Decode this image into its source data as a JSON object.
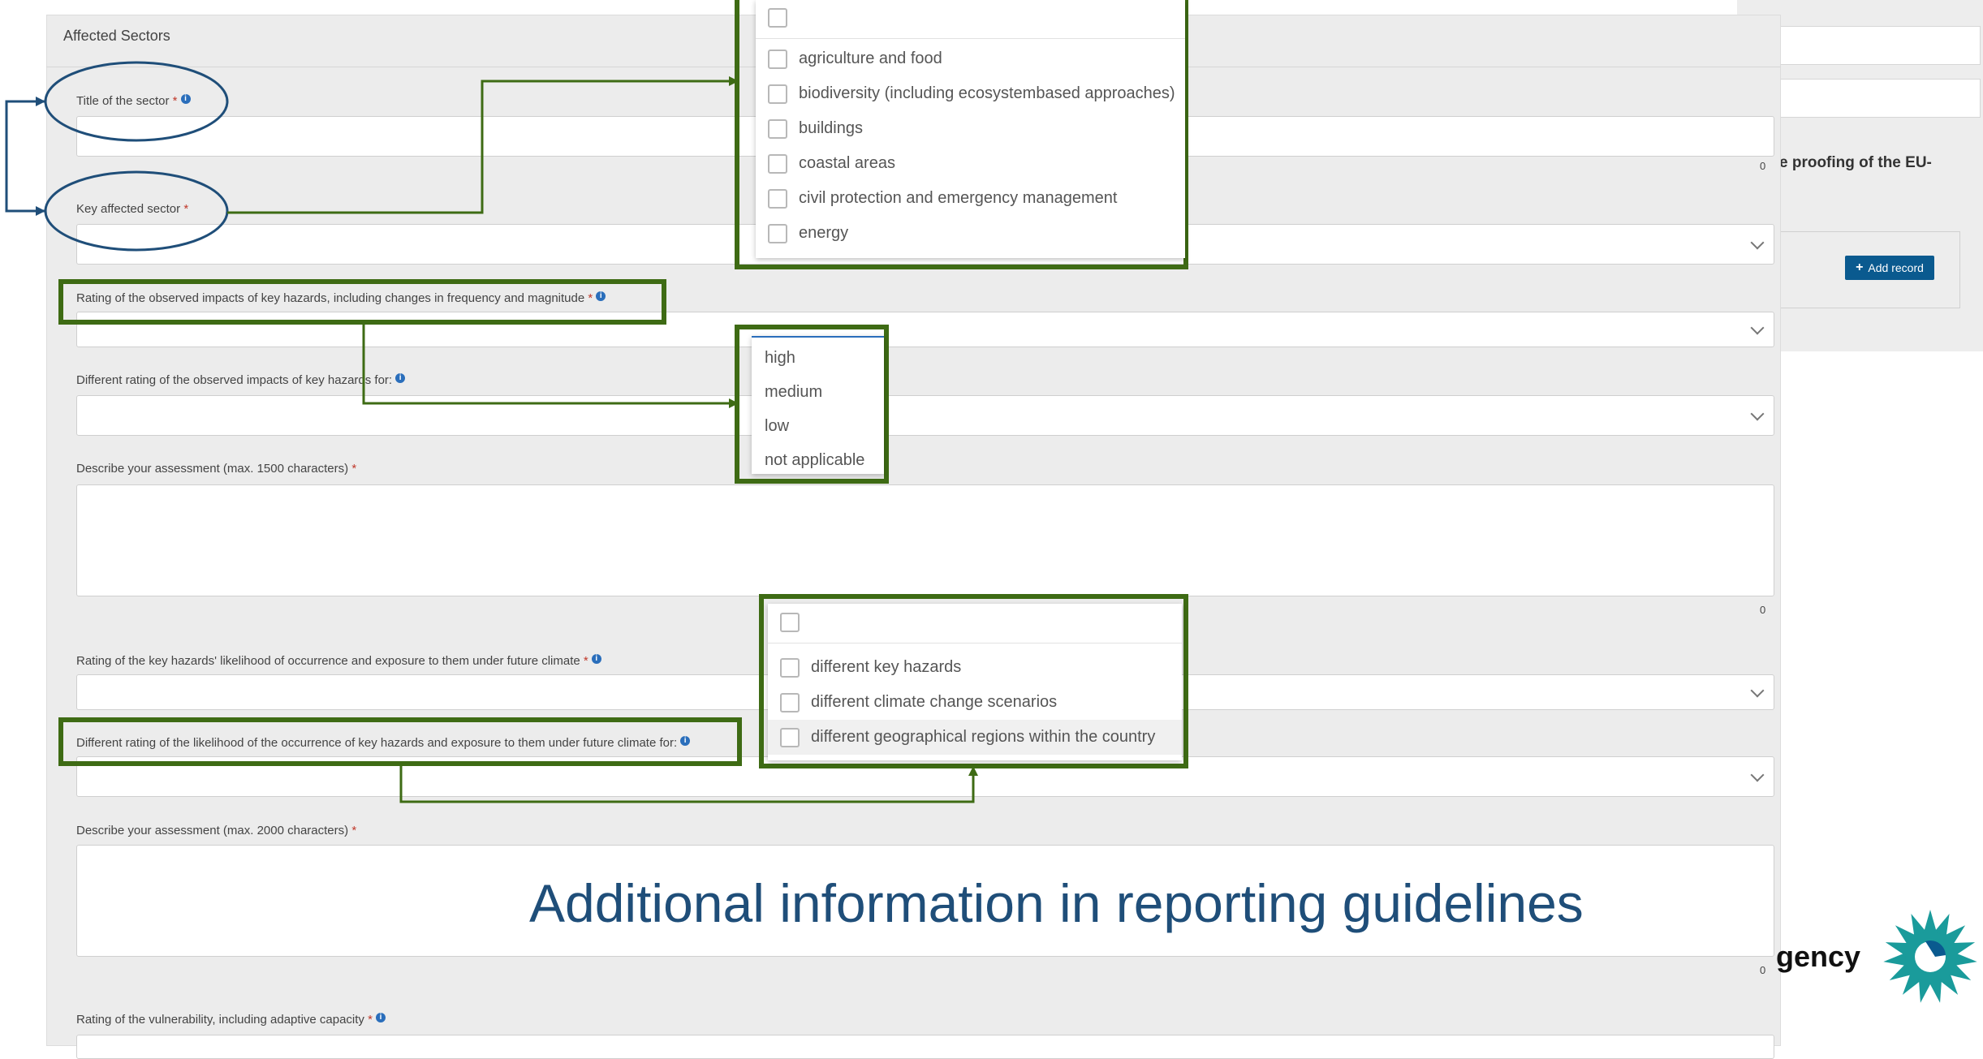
{
  "background": {
    "heading_fragment": "e proofing of the EU-",
    "add_record_label": "Add record",
    "plus_icon": "+",
    "counter": "0"
  },
  "form": {
    "section_title": "Affected Sectors",
    "required_mark": "*",
    "info_icon": "i",
    "title_of_sector": {
      "label": "Title of the sector",
      "counter": "0"
    },
    "key_affected_sector": {
      "label": "Key affected sector"
    },
    "rating_observed": {
      "label": "Rating of the observed impacts of key hazards, including changes in frequency and magnitude"
    },
    "different_rating_observed": {
      "label": "Different rating of the observed impacts of key hazards for:"
    },
    "describe_1500": {
      "label": "Describe your assessment (max. 1500 characters)",
      "counter": "0"
    },
    "rating_future": {
      "label": "Rating of the key hazards' likelihood of occurrence and exposure to them under future climate"
    },
    "different_rating_future": {
      "label": "Different rating of the likelihood of the occurrence of key hazards and exposure to them under future climate for:"
    },
    "describe_2000": {
      "label": "Describe your assessment (max. 2000 characters)",
      "counter": "0"
    },
    "rating_vulnerability": {
      "label": "Rating of the vulnerability, including adaptive capacity"
    }
  },
  "sector_dropdown": {
    "options": [
      "agriculture and food",
      "biodiversity (including ecosystembased approaches)",
      "buildings",
      "coastal areas",
      "civil protection and emergency management",
      "energy"
    ]
  },
  "rating_dropdown": {
    "options": [
      "high",
      "medium",
      "low",
      "not applicable"
    ]
  },
  "future_dropdown": {
    "options": [
      "different key hazards",
      "different climate change scenarios",
      "different geographical regions within the country"
    ]
  },
  "overlay": {
    "title": "Additional information in reporting guidelines",
    "agency_fragment": "gency"
  },
  "colors": {
    "highlight": "#3e6b14",
    "overlay_text": "#1f4e79",
    "button": "#0a5a8f",
    "info": "#2a6ebb",
    "required": "#c0392b"
  }
}
